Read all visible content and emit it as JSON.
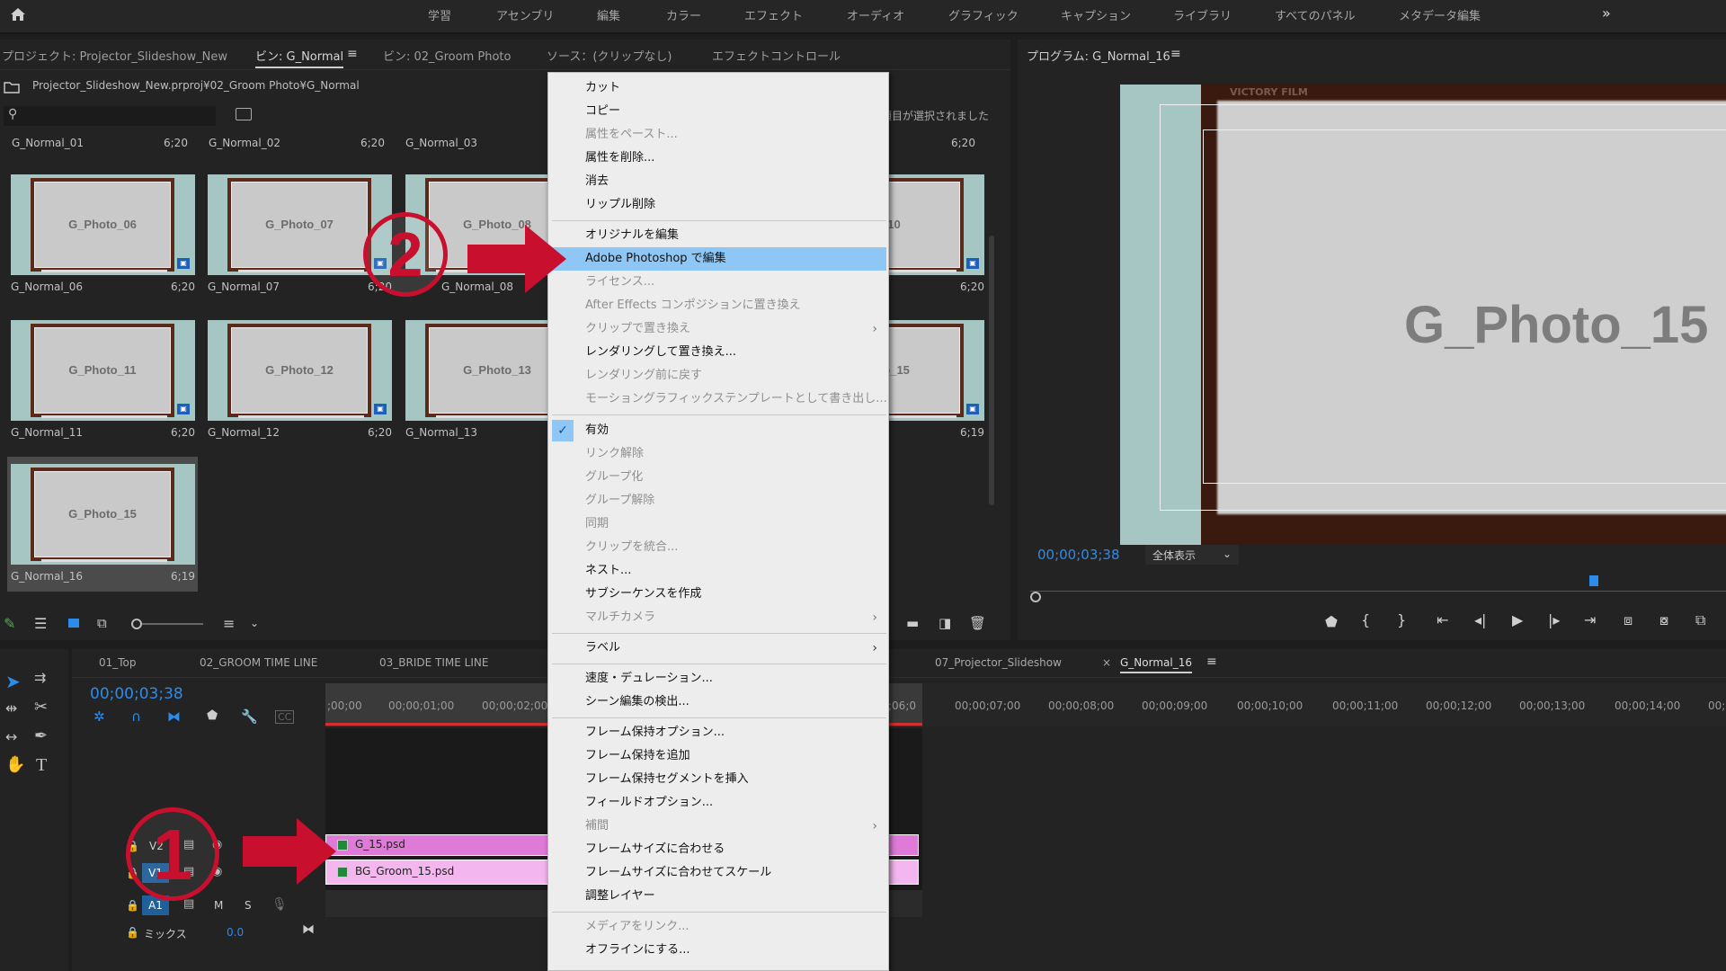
{
  "topbar": {
    "workspaces": [
      "学習",
      "アセンブリ",
      "編集",
      "カラー",
      "エフェクト",
      "オーディオ",
      "グラフィック",
      "キャプション",
      "ライブラリ",
      "すべてのパネル",
      "メタデータ編集"
    ],
    "more": "»"
  },
  "project": {
    "tabs": [
      "プロジェクト: Projector_Slideshow_New",
      "ビン: G_Normal",
      "ビン: 02_Groom Photo",
      "ソース：(クリップなし)",
      "エフェクトコントロール"
    ],
    "path": "Projector_Slideshow_New.prproj¥02_Groom Photo¥G_Normal",
    "status": "項目が選択されました",
    "search_placeholder": ""
  },
  "grid": {
    "toprow": [
      {
        "name": "G_Normal_01",
        "dur": "6;20"
      },
      {
        "name": "G_Normal_02",
        "dur": "6;20"
      },
      {
        "name": "G_Normal_03",
        "dur": ""
      },
      {
        "name": "",
        "dur": "6;20"
      }
    ],
    "row1": [
      {
        "photo": "G_Photo_06",
        "name": "G_Normal_06",
        "dur": "6;20"
      },
      {
        "photo": "G_Photo_07",
        "name": "G_Normal_07",
        "dur": "6;20"
      },
      {
        "photo": "G_Photo_08",
        "name": "G_Normal_08",
        "dur": ""
      },
      {
        "photo": "_10",
        "name": "",
        "dur": "6;20"
      }
    ],
    "row2": [
      {
        "photo": "G_Photo_11",
        "name": "G_Normal_11",
        "dur": "6;20"
      },
      {
        "photo": "G_Photo_12",
        "name": "G_Normal_12",
        "dur": "6;20"
      },
      {
        "photo": "G_Photo_13",
        "name": "G_Normal_13",
        "dur": ""
      },
      {
        "photo": "oto_15",
        "name": "",
        "dur": "6;19"
      }
    ],
    "row3": [
      {
        "photo": "G_Photo_15",
        "name": "G_Normal_16",
        "dur": "6;19"
      }
    ]
  },
  "program": {
    "title": "プログラム: G_Normal_16",
    "frame_text": "G_Photo_15",
    "timecode": "00;00;03;38",
    "zoom": "全体表示",
    "top_text": "VICTORY FILM"
  },
  "menu": {
    "items": [
      {
        "label": "カット",
        "enabled": true
      },
      {
        "label": "コピー",
        "enabled": true
      },
      {
        "label": "属性をペースト...",
        "enabled": false
      },
      {
        "label": "属性を削除...",
        "enabled": true
      },
      {
        "label": "消去",
        "enabled": true
      },
      {
        "label": "リップル削除",
        "enabled": true
      },
      {
        "label": "オリジナルを編集",
        "enabled": true
      },
      {
        "label": "Adobe Photoshop で編集",
        "enabled": true,
        "highlight": true
      },
      {
        "label": "ライセンス...",
        "enabled": false
      },
      {
        "label": "After Effects コンポジションに置き換え",
        "enabled": false
      },
      {
        "label": "クリップで置き換え",
        "enabled": false,
        "submenu": true
      },
      {
        "label": "レンダリングして置き換え...",
        "enabled": true
      },
      {
        "label": "レンダリング前に戻す",
        "enabled": false
      },
      {
        "label": "モーショングラフィックステンプレートとして書き出し...",
        "enabled": false
      },
      {
        "label": "有効",
        "enabled": true,
        "checked": true
      },
      {
        "label": "リンク解除",
        "enabled": false
      },
      {
        "label": "グループ化",
        "enabled": false
      },
      {
        "label": "グループ解除",
        "enabled": false
      },
      {
        "label": "同期",
        "enabled": false
      },
      {
        "label": "クリップを統合...",
        "enabled": false
      },
      {
        "label": "ネスト...",
        "enabled": true
      },
      {
        "label": "サブシーケンスを作成",
        "enabled": true
      },
      {
        "label": "マルチカメラ",
        "enabled": false,
        "submenu": true
      },
      {
        "label": "ラベル",
        "enabled": true,
        "submenu": true
      },
      {
        "label": "速度・デュレーション...",
        "enabled": true
      },
      {
        "label": "シーン編集の検出...",
        "enabled": true
      },
      {
        "label": "フレーム保持オプション...",
        "enabled": true
      },
      {
        "label": "フレーム保持を追加",
        "enabled": true
      },
      {
        "label": "フレーム保持セグメントを挿入",
        "enabled": true
      },
      {
        "label": "フィールドオプション...",
        "enabled": true
      },
      {
        "label": "補間",
        "enabled": false,
        "submenu": true
      },
      {
        "label": "フレームサイズに合わせる",
        "enabled": true
      },
      {
        "label": "フレームサイズに合わせてスケール",
        "enabled": true
      },
      {
        "label": "調整レイヤー",
        "enabled": true
      },
      {
        "label": "メディアをリンク...",
        "enabled": false
      },
      {
        "label": "オフラインにする...",
        "enabled": true
      }
    ]
  },
  "timeline": {
    "tabs": [
      "01_Top",
      "02_GROOM TIME LINE",
      "03_BRIDE TIME LINE",
      "07_Projector_Slideshow",
      "G_Normal_16"
    ],
    "close": "×",
    "timecode": "00;00;03;38",
    "ticks_left": [
      ";00;00",
      "00;00;01;00",
      "00;00;02;00"
    ],
    "tick_mid": ";06;0",
    "ticks_right": [
      "00;00;07;00",
      "00;00;08;00",
      "00;00;09;00",
      "00;00;10;00",
      "00;00;11;00",
      "00;00;12;00",
      "00;00;13;00",
      "00;00;14;00",
      "00;"
    ],
    "tracks": {
      "v2": "V2",
      "v1": "V1",
      "a1": "A1",
      "mix": "ミックス",
      "mix_val": "0.0",
      "m": "M",
      "s": "S"
    },
    "clips": {
      "v2": "G_15.psd",
      "v1": "BG_Groom_15.psd"
    }
  },
  "annotations": {
    "one": "1",
    "two": "2"
  },
  "colors": {
    "accent": "#2d8ceb",
    "clip_v2": "#e07ad9",
    "clip_v1": "#f4b6ee",
    "arrow": "#c8102e",
    "highlight": "#8ec7f6"
  }
}
